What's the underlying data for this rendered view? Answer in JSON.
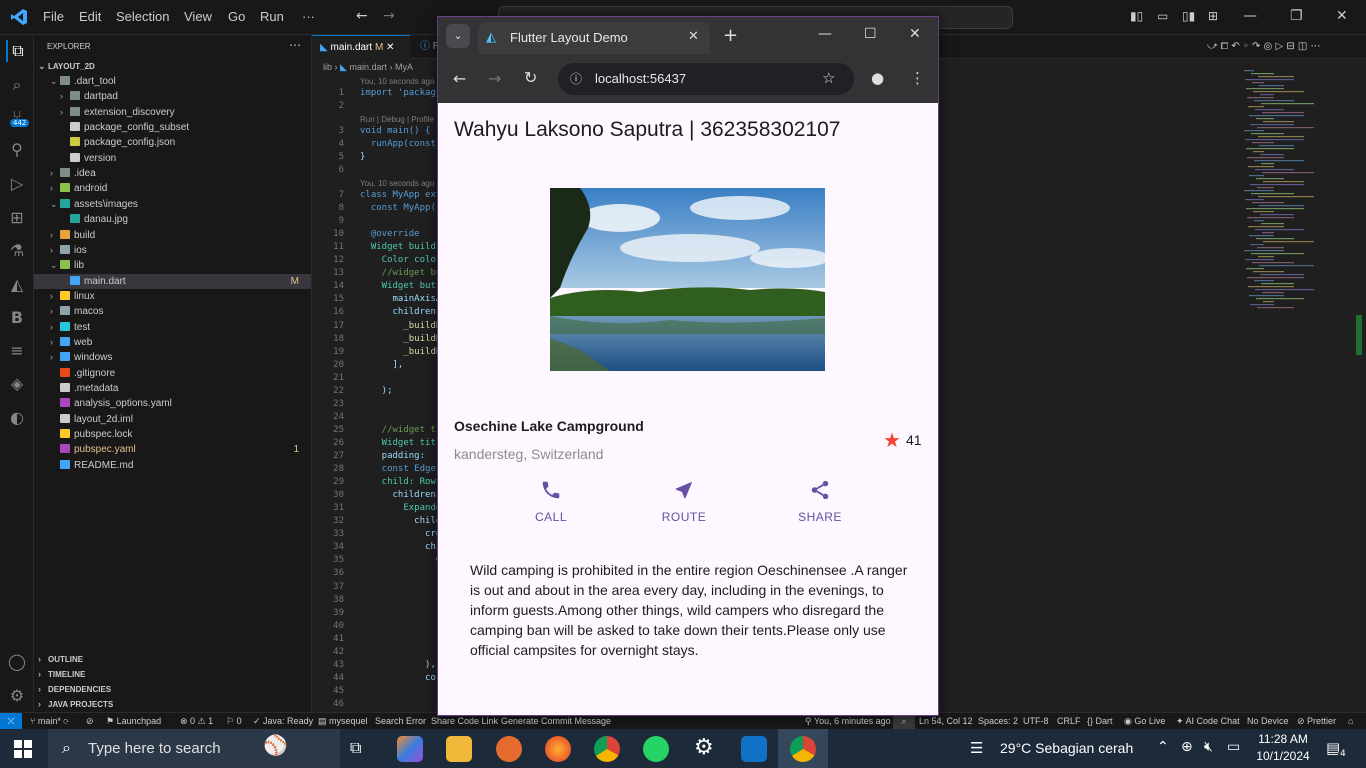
{
  "vscode": {
    "menu": [
      "File",
      "Edit",
      "Selection",
      "View",
      "Go",
      "Run",
      "···"
    ],
    "explorer_title": "EXPLORER",
    "project": "LAYOUT_2D",
    "tree": [
      {
        "label": ".dart_tool",
        "depth": 1,
        "open": true,
        "color": "#7f8c8d"
      },
      {
        "label": "dartpad",
        "depth": 2,
        "open": false,
        "color": "#7f8c8d"
      },
      {
        "label": "extension_discovery",
        "depth": 2,
        "open": false,
        "color": "#7f8c8d"
      },
      {
        "label": "package_config_subset",
        "depth": 2,
        "file": true,
        "color": "#cccccc"
      },
      {
        "label": "package_config.json",
        "depth": 2,
        "file": true,
        "color": "#cbcb41"
      },
      {
        "label": "version",
        "depth": 2,
        "file": true,
        "color": "#cccccc"
      },
      {
        "label": ".idea",
        "depth": 1,
        "open": false,
        "color": "#7f8c8d"
      },
      {
        "label": "android",
        "depth": 1,
        "open": false,
        "color": "#8bc34a"
      },
      {
        "label": "assets\\images",
        "depth": 1,
        "open": true,
        "color": "#26a69a"
      },
      {
        "label": "danau.jpg",
        "depth": 2,
        "file": true,
        "color": "#26a69a"
      },
      {
        "label": "build",
        "depth": 1,
        "open": false,
        "color": "#e8a33d"
      },
      {
        "label": "ios",
        "depth": 1,
        "open": false,
        "color": "#90a4ae"
      },
      {
        "label": "lib",
        "depth": 1,
        "open": true,
        "color": "#8bc34a"
      },
      {
        "label": "main.dart",
        "depth": 2,
        "file": true,
        "color": "#42a5f5",
        "selected": true,
        "badge": "M"
      },
      {
        "label": "linux",
        "depth": 1,
        "open": false,
        "color": "#ffca28"
      },
      {
        "label": "macos",
        "depth": 1,
        "open": false,
        "color": "#90a4ae"
      },
      {
        "label": "test",
        "depth": 1,
        "open": false,
        "color": "#26c6da"
      },
      {
        "label": "web",
        "depth": 1,
        "open": false,
        "color": "#42a5f5"
      },
      {
        "label": "windows",
        "depth": 1,
        "open": false,
        "color": "#42a5f5"
      },
      {
        "label": ".gitignore",
        "depth": 1,
        "file": true,
        "color": "#e64a19"
      },
      {
        "label": ".metadata",
        "depth": 1,
        "file": true,
        "color": "#cccccc"
      },
      {
        "label": "analysis_options.yaml",
        "depth": 1,
        "file": true,
        "color": "#ab47bc"
      },
      {
        "label": "layout_2d.iml",
        "depth": 1,
        "file": true,
        "color": "#cccccc"
      },
      {
        "label": "pubspec.lock",
        "depth": 1,
        "file": true,
        "color": "#ffca28"
      },
      {
        "label": "pubspec.yaml",
        "depth": 1,
        "file": true,
        "color": "#ab47bc",
        "badge": "1"
      },
      {
        "label": "README.md",
        "depth": 1,
        "file": true,
        "color": "#42a5f5"
      }
    ],
    "panels": [
      "OUTLINE",
      "TIMELINE",
      "DEPENDENCIES",
      "JAVA PROJECTS"
    ],
    "tab_active": "main.dart",
    "tab_active_badge": "M",
    "tab_next": "RE",
    "breadcrumb": [
      "lib",
      "main.dart",
      "MyA"
    ],
    "blame1": "You, 10 seconds ago",
    "blame2": "You, 10 seconds ago",
    "codelens": "Run | Debug | Profile",
    "code": [
      {
        "n": "1",
        "t": "import 'packag"
      },
      {
        "n": "2",
        "t": ""
      },
      {
        "n": "3",
        "t": "void main() {"
      },
      {
        "n": "4",
        "t": "  runApp(const"
      },
      {
        "n": "5",
        "t": "}"
      },
      {
        "n": "6",
        "t": ""
      },
      {
        "n": "7",
        "t": "class MyApp ext"
      },
      {
        "n": "8",
        "t": "  const MyApp({"
      },
      {
        "n": "9",
        "t": ""
      },
      {
        "n": "10",
        "t": "  @override"
      },
      {
        "n": "11",
        "t": "  Widget build"
      },
      {
        "n": "12",
        "t": "    Color colo"
      },
      {
        "n": "13",
        "t": "    //widget bu"
      },
      {
        "n": "14",
        "t": "    Widget butt"
      },
      {
        "n": "15",
        "t": "      mainAxisA"
      },
      {
        "n": "16",
        "t": "      children"
      },
      {
        "n": "17",
        "t": "        _buildB"
      },
      {
        "n": "18",
        "t": "        _buildB"
      },
      {
        "n": "19",
        "t": "        _buildB"
      },
      {
        "n": "20",
        "t": "      ],"
      },
      {
        "n": "21",
        "t": ""
      },
      {
        "n": "22",
        "t": "    );"
      },
      {
        "n": "23",
        "t": ""
      },
      {
        "n": "24",
        "t": ""
      },
      {
        "n": "25",
        "t": "    //widget titl"
      },
      {
        "n": "26",
        "t": "    Widget titleS"
      },
      {
        "n": "27",
        "t": "    padding:"
      },
      {
        "n": "28",
        "t": "    const EdgeIns"
      },
      {
        "n": "29",
        "t": "    child: Row("
      },
      {
        "n": "30",
        "t": "      children: ["
      },
      {
        "n": "31",
        "t": "        Expanded("
      },
      {
        "n": "32",
        "t": "          child:"
      },
      {
        "n": "33",
        "t": "            cros"
      },
      {
        "n": "34",
        "t": "            chil"
      },
      {
        "n": "35",
        "t": "              Co"
      },
      {
        "n": "36",
        "t": ""
      },
      {
        "n": "37",
        "t": ""
      },
      {
        "n": "38",
        "t": ""
      },
      {
        "n": "39",
        "t": ""
      },
      {
        "n": "40",
        "t": ""
      },
      {
        "n": "41",
        "t": ""
      },
      {
        "n": "42",
        "t": ""
      },
      {
        "n": "43",
        "t": "            ),"
      },
      {
        "n": "44",
        "t": "            co"
      },
      {
        "n": "45",
        "t": ""
      },
      {
        "n": "46",
        "t": ""
      }
    ],
    "status": {
      "branch": "main*",
      "launchpad": "Launchpad",
      "errors": "0",
      "warnings": "1",
      "ports": "0",
      "java": "Java: Ready",
      "mysql": "mysequel",
      "search_error": "Search Error",
      "share": "Share Code Link",
      "commit": "Generate Commit Message",
      "blame": "You, 6 minutes ago",
      "position": "Ln 54, Col 12",
      "spaces": "Spaces: 2",
      "encoding": "UTF-8",
      "eol": "CRLF",
      "lang": "Dart",
      "golive": "Go Live",
      "aichat": "AI Code Chat",
      "device": "No Device",
      "prettier": "Prettier"
    },
    "scm_badge": "442"
  },
  "chrome": {
    "tab_title": "Flutter Layout Demo",
    "url": "localhost:56437"
  },
  "app": {
    "title": "Wahyu Laksono Saputra | 362358302107",
    "place_title": "Osechine Lake Campground",
    "place_subtitle": "kandersteg, Switzerland",
    "rating": "41",
    "buttons": [
      {
        "label": "CALL",
        "icon": "phone-icon"
      },
      {
        "label": "ROUTE",
        "icon": "near-me-icon"
      },
      {
        "label": "SHARE",
        "icon": "share-icon"
      }
    ],
    "description": "Wild camping is prohibited in the entire region Oeschinensee .A ranger is out and about in the area every day, including in the evenings, to inform guests.Among other things, wild campers who disregard the camping ban will be asked to take down their tents.Please only use official campsites for overnight stays.",
    "accent": "#6750a4",
    "star_color": "#f44336"
  },
  "taskbar": {
    "search_placeholder": "Type here to search",
    "weather": "29°C  Sebagian cerah",
    "time": "11:28 AM",
    "date": "10/1/2024",
    "notif": "4"
  }
}
